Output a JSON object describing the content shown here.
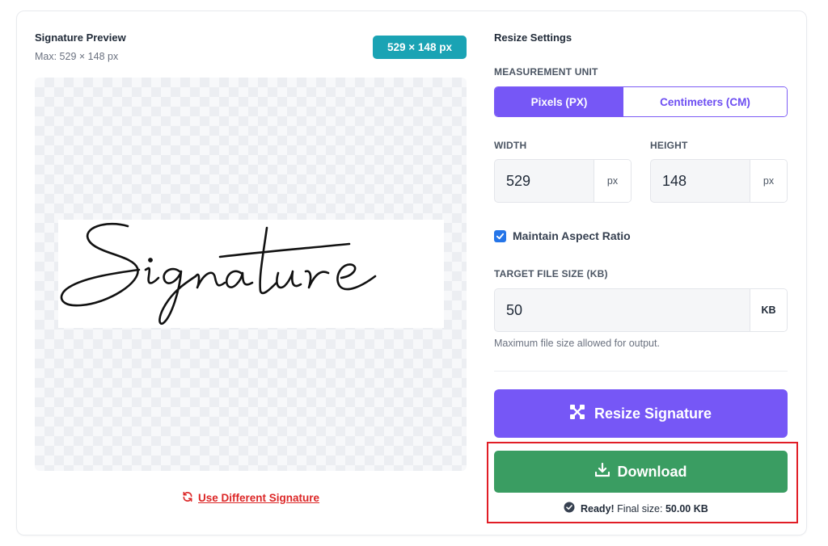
{
  "preview": {
    "title": "Signature Preview",
    "max_text": "Max: 529 × 148 px",
    "dimension_badge": "529 × 148 px",
    "signature_text": "Signature",
    "use_different_label": "Use Different Signature"
  },
  "settings": {
    "title": "Resize Settings",
    "measurement_unit_label": "MEASUREMENT UNIT",
    "units": [
      {
        "label": "Pixels (PX)",
        "active": true
      },
      {
        "label": "Centimeters (CM)",
        "active": false
      }
    ],
    "width_label": "WIDTH",
    "width_value": "529",
    "width_unit": "px",
    "height_label": "HEIGHT",
    "height_value": "148",
    "height_unit": "px",
    "aspect_ratio_label": "Maintain Aspect Ratio",
    "aspect_ratio_checked": true,
    "target_size_label": "TARGET FILE SIZE (KB)",
    "target_size_value": "50",
    "target_size_unit": "KB",
    "target_size_helper": "Maximum file size allowed for output.",
    "resize_button_label": "Resize Signature",
    "download_button_label": "Download",
    "status_ready": "Ready!",
    "status_text": "Final size:",
    "status_size": "50.00 KB"
  },
  "colors": {
    "accent_purple": "#7657f6",
    "badge_teal": "#1aa3b4",
    "download_green": "#3a9d62",
    "link_red": "#dc2626",
    "checkbox_blue": "#2575e8",
    "highlight_red": "#e11d26"
  },
  "icons": {
    "resize": "resize-icon",
    "download": "download-icon",
    "refresh": "refresh-icon",
    "check_circle": "check-circle-icon",
    "checkbox": "checkmark-icon"
  }
}
